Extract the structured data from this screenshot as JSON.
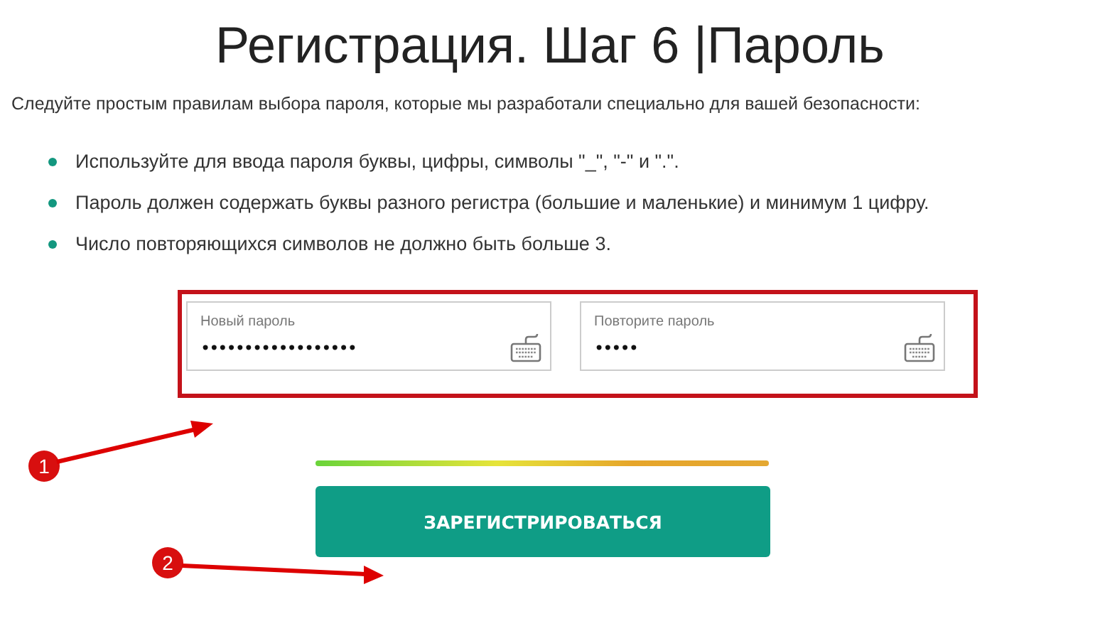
{
  "title": "Регистрация. Шаг 6 |Пароль",
  "subtitle": "Следуйте простым правилам выбора пароля, которые мы разработали специально для вашей безопасности:",
  "rules": [
    "Используйте для ввода пароля буквы, цифры, символы \"_\", \"-\" и \".\".",
    "Пароль должен содержать буквы разного регистра (большие и маленькие) и минимум 1 цифру.",
    "Число повторяющихся символов не должно быть больше 3."
  ],
  "fields": [
    {
      "label": "Новый пароль",
      "value": "••••••••••••••••••"
    },
    {
      "label": "Повторите пароль",
      "value": "•••••"
    }
  ],
  "strength": {
    "level": 1
  },
  "submit_button": "ЗАРЕГИСТРИРОВАТЬСЯ",
  "annotations": [
    {
      "number": "1"
    },
    {
      "number": "2"
    }
  ]
}
